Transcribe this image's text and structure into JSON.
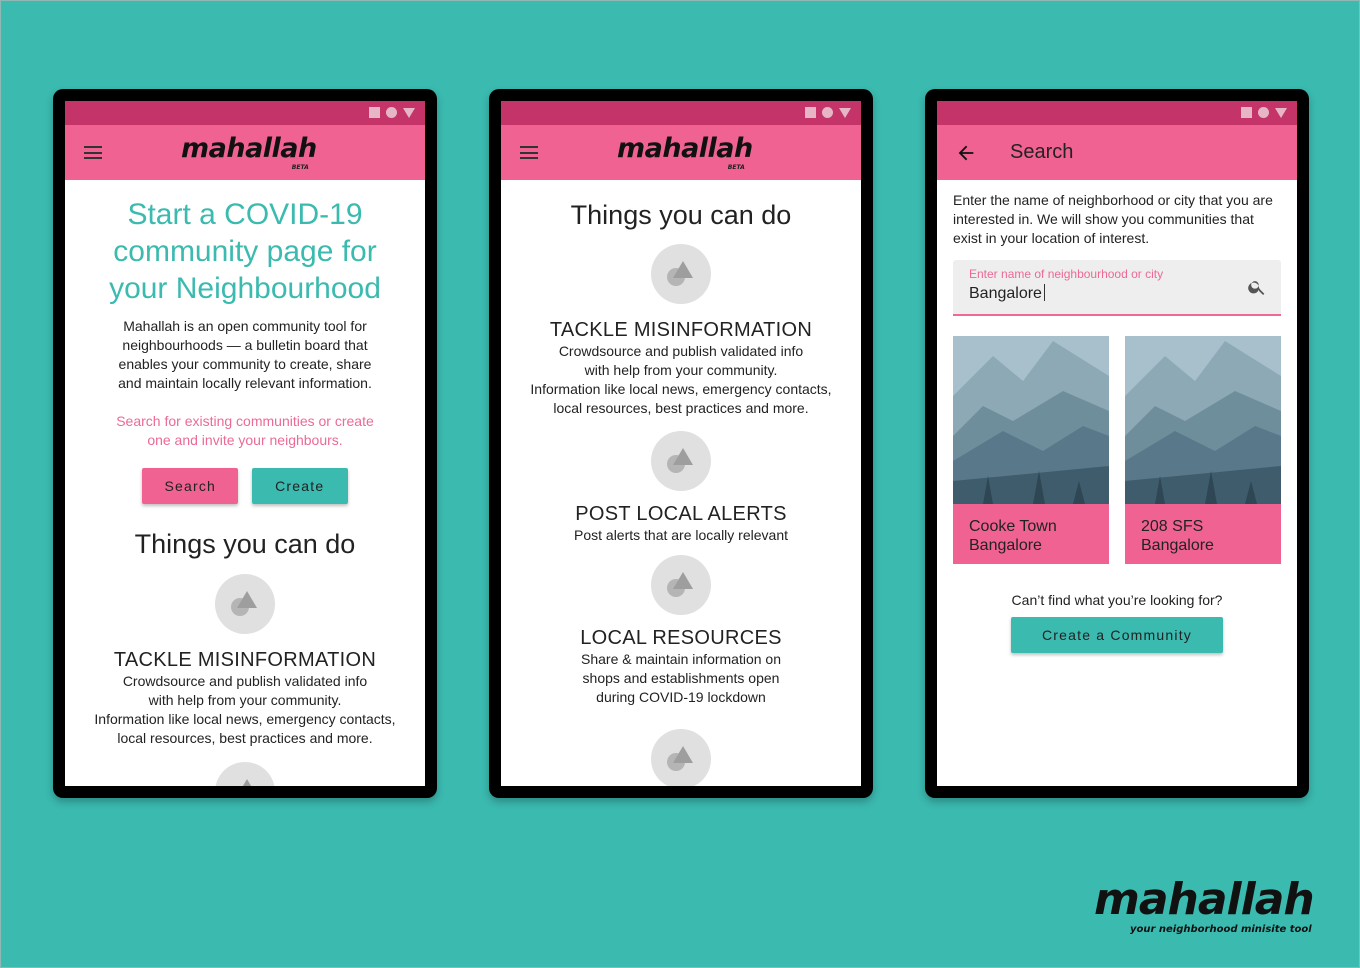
{
  "colors": {
    "background": "#3bbab0",
    "primary_pink": "#f06292",
    "status_bar": "#c43469",
    "teal": "#3bbab0"
  },
  "brand": {
    "logo": "mahallah",
    "beta": "BETA",
    "tagline": "your neighborhood minisite tool"
  },
  "screen1": {
    "hero_title": "Start a COVID-19 community page for your Neighbourhood",
    "intro": "Mahallah is an open community tool for neighbourhoods — a bulletin board that enables your community to create, share and maintain locally relevant information.",
    "cta_text": "Search for existing communities or create one and invite your neighbours.",
    "search_button": "Search",
    "create_button": "Create",
    "things_heading": "Things you can do",
    "feature_title": "TACKLE MISINFORMATION",
    "feature_desc_1": "Crowdsource and publish validated info",
    "feature_desc_2": "with help from your community.",
    "feature_desc_3": "Information like local news, emergency contacts,",
    "feature_desc_4": "local resources, best practices and more."
  },
  "screen2": {
    "things_heading": "Things you can do",
    "features": [
      {
        "title": "TACKLE MISINFORMATION",
        "lines": [
          "Crowdsource and publish validated info",
          "with help from your community.",
          "Information like local news, emergency contacts,",
          "local resources, best practices and more."
        ]
      },
      {
        "title": "POST LOCAL ALERTS",
        "lines": [
          "Post alerts that are locally relevant"
        ]
      },
      {
        "title": "LOCAL RESOURCES",
        "lines": [
          "Share & maintain information on",
          "shops and establishments open",
          "during COVID-19 lockdown"
        ]
      }
    ]
  },
  "screen3": {
    "title": "Search",
    "intro": "Enter the name of neighborhood or city that you are interested in. We will show you communities that exist in your location of interest.",
    "field_label": "Enter name of neighbourhood or city",
    "field_value": "Bangalore",
    "results": [
      {
        "line1": "Cooke Town",
        "line2": "Bangalore"
      },
      {
        "line1": "208 SFS",
        "line2": "Bangalore"
      }
    ],
    "not_found": "Can’t find what you’re looking for?",
    "create_button": "Create a Community"
  },
  "icons": [
    "menu-icon",
    "back-arrow-icon",
    "search-icon",
    "shapes-icon"
  ]
}
